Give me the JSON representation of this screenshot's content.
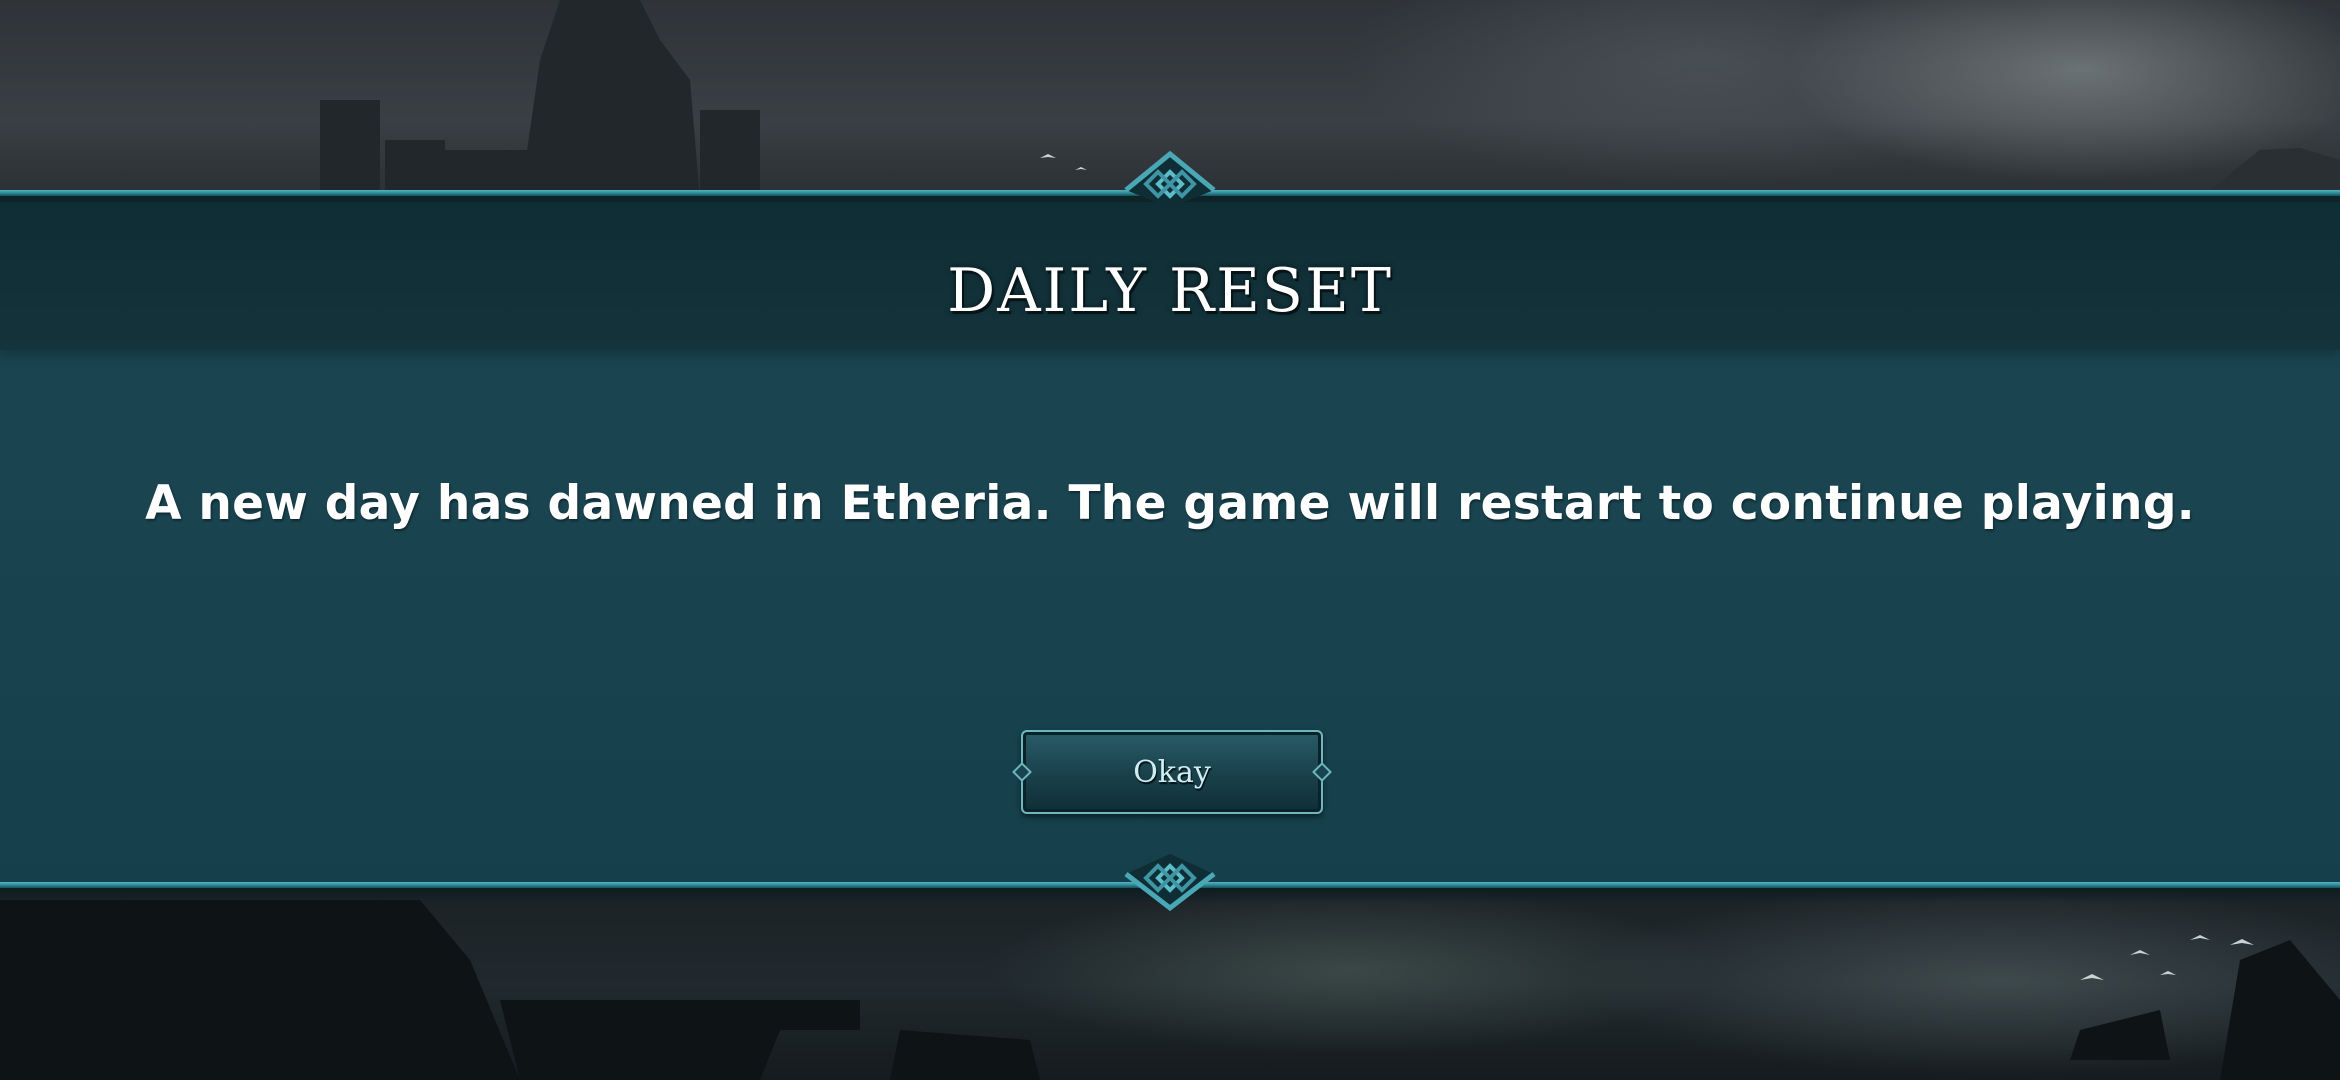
{
  "dialog": {
    "title": "DAILY RESET",
    "message": "A new day has dawned in Etheria. The game will restart to continue playing.",
    "okay_label": "Okay"
  },
  "colors": {
    "panel": "#1a4450",
    "header": "#12313a",
    "border_accent": "#4aa8b6",
    "text": "#ffffff"
  },
  "icons": {
    "top_ornament": "diamond-knot-icon",
    "bottom_ornament": "diamond-knot-icon"
  }
}
